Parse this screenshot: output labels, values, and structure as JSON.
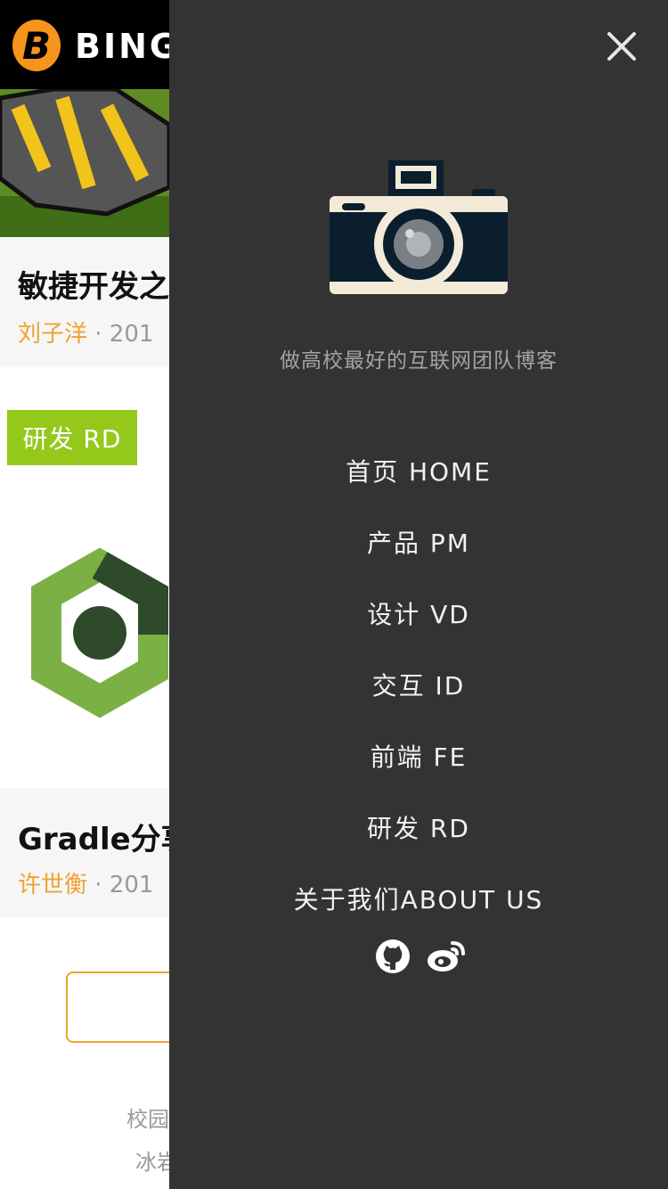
{
  "header": {
    "logo_letter": "B",
    "logo_text": "BING"
  },
  "posts": [
    {
      "title": "敏捷开发之",
      "author": "刘子洋",
      "date": "· 201"
    },
    {
      "title": "Gradle分享",
      "author": "许世衡",
      "date": "· 201"
    }
  ],
  "tag": {
    "label": "研发 RD"
  },
  "footer": {
    "line1": "校园",
    "line2": "冰岩"
  },
  "drawer": {
    "slogan": "做高校最好的互联网团队博客",
    "menu": [
      {
        "label": "首页 HOME"
      },
      {
        "label": "产品 PM"
      },
      {
        "label": "设计 VD"
      },
      {
        "label": "交互 ID"
      },
      {
        "label": "前端 FE"
      },
      {
        "label": "研发 RD"
      },
      {
        "label": "关于我们ABOUT US"
      }
    ],
    "icons": {
      "close": "close-icon",
      "camera": "camera-icon",
      "github": "github-icon",
      "weibo": "weibo-icon"
    }
  },
  "colors": {
    "accent": "#f0a22e",
    "tag": "#94c91c",
    "drawer_bg": "#333333"
  }
}
